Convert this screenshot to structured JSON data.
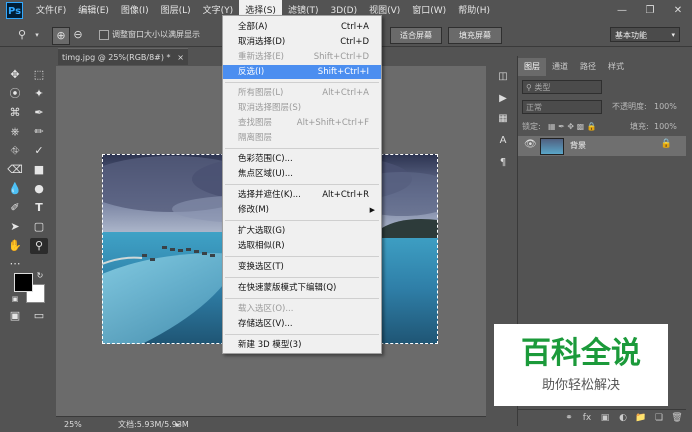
{
  "app": {
    "logo": "Ps"
  },
  "menubar": {
    "items": [
      "文件(F)",
      "编辑(E)",
      "图像(I)",
      "图层(L)",
      "文字(Y)",
      "选择(S)",
      "滤镜(T)",
      "3D(D)",
      "视图(V)",
      "窗口(W)",
      "帮助(H)"
    ],
    "active_index": 5
  },
  "window_controls": [
    "minimize-icon",
    "restore-icon",
    "close-icon"
  ],
  "options": {
    "resize_window_label": "调整窗口大小以满屏显示",
    "fit_screen_label": "适合屏幕",
    "fill_screen_label": "填充屏幕",
    "workspace": "基本功能"
  },
  "document": {
    "tab_title": "timg.jpg @ 25%(RGB/8#) *",
    "zoom": "25%",
    "doc_size": "文档:5.93M/5.93M"
  },
  "select_menu": {
    "items": [
      {
        "label": "全部(A)",
        "shortcut": "Ctrl+A",
        "enabled": true
      },
      {
        "label": "取消选择(D)",
        "shortcut": "Ctrl+D",
        "enabled": true
      },
      {
        "label": "重新选择(E)",
        "shortcut": "Shift+Ctrl+D",
        "enabled": false
      },
      {
        "label": "反选(I)",
        "shortcut": "Shift+Ctrl+I",
        "enabled": true,
        "highlighted": true
      },
      {
        "label": "所有图层(L)",
        "shortcut": "Alt+Ctrl+A",
        "enabled": false
      },
      {
        "label": "取消选择图层(S)",
        "shortcut": "",
        "enabled": false
      },
      {
        "label": "查找图层",
        "shortcut": "Alt+Shift+Ctrl+F",
        "enabled": false
      },
      {
        "label": "隔离图层",
        "shortcut": "",
        "enabled": false
      },
      {
        "label": "色彩范围(C)...",
        "shortcut": "",
        "enabled": true
      },
      {
        "label": "焦点区域(U)...",
        "shortcut": "",
        "enabled": true
      },
      {
        "label": "选择并遮住(K)...",
        "shortcut": "Alt+Ctrl+R",
        "enabled": true
      },
      {
        "label": "修改(M)",
        "shortcut": "",
        "enabled": true,
        "submenu": true
      },
      {
        "label": "扩大选取(G)",
        "shortcut": "",
        "enabled": true
      },
      {
        "label": "选取相似(R)",
        "shortcut": "",
        "enabled": true
      },
      {
        "label": "变换选区(T)",
        "shortcut": "",
        "enabled": true
      },
      {
        "label": "在快速蒙版模式下编辑(Q)",
        "shortcut": "",
        "enabled": true
      },
      {
        "label": "载入选区(O)...",
        "shortcut": "",
        "enabled": false
      },
      {
        "label": "存储选区(V)...",
        "shortcut": "",
        "enabled": true
      },
      {
        "label": "新建 3D 模型(3)",
        "shortcut": "",
        "enabled": true
      }
    ]
  },
  "layers_panel": {
    "tabs": [
      "图层",
      "通道",
      "路径",
      "样式"
    ],
    "active_tab": 0,
    "filter_kind": "类型",
    "blend_mode": "正常",
    "opacity_label": "不透明度:",
    "opacity_value": "100%",
    "lock_label": "锁定:",
    "fill_label": "填充:",
    "fill_value": "100%",
    "layers": [
      {
        "name": "背景",
        "locked": true,
        "visible": true
      }
    ]
  },
  "watermark": {
    "title": "百科全说",
    "subtitle": "助你轻松解决"
  },
  "colors": {
    "accent": "#4b8ef0",
    "ui_bg": "#535353",
    "canvas_bg": "#6b6b6b",
    "watermark_green": "#1b9a3a"
  }
}
